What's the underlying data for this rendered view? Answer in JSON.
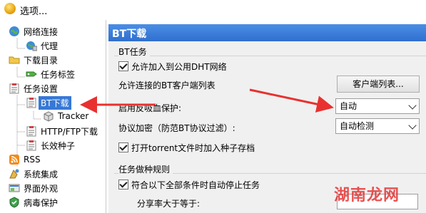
{
  "window": {
    "title": "选项..."
  },
  "tree": {
    "items": [
      {
        "label": "网络连接",
        "icon": "network-globe-icon"
      },
      {
        "label": "代理",
        "icon": "proxy-globe-icon"
      },
      {
        "label": "下载目录",
        "icon": "folder-icon"
      },
      {
        "label": "任务标签",
        "icon": "tag-icon"
      },
      {
        "label": "任务设置",
        "icon": "task-settings-icon"
      },
      {
        "label": "BT下载",
        "icon": "bt-task-icon"
      },
      {
        "label": "Tracker",
        "icon": "tracker-box-icon"
      },
      {
        "label": "HTTP/FTP下载",
        "icon": "http-ftp-icon"
      },
      {
        "label": "长效种子",
        "icon": "long-seed-icon"
      },
      {
        "label": "RSS",
        "icon": "rss-icon"
      },
      {
        "label": "系统集成",
        "icon": "system-integration-icon"
      },
      {
        "label": "界面外观",
        "icon": "appearance-icon"
      },
      {
        "label": "病毒保护",
        "icon": "virus-protection-icon"
      }
    ],
    "selected": "BT下载"
  },
  "panel": {
    "header": "BT下载",
    "bt_group": {
      "title": "BT任务",
      "allow_dht_label": "允许加入到公用DHT网络",
      "allow_dht_checked": true,
      "allowed_clients_label": "允许连接的BT客户端列表",
      "client_list_button": "客户端列表...",
      "anti_leech_label": "启用反吸血保护:",
      "anti_leech_value": "自动",
      "encryption_label": "协议加密（防范BT协议过滤）:",
      "encryption_value": "自动检测",
      "torrent_seed_label": "打开torrent文件时加入种子存档",
      "torrent_seed_checked": true
    },
    "seed_rules_group": {
      "title": "任务做种规则",
      "stop_all_label": "符合以下全部条件时自动停止任务",
      "stop_all_checked": true,
      "share_ratio_label": "分享率大于等于:"
    }
  },
  "watermark": "湖南龙网",
  "colors": {
    "header": "#3778d6",
    "selection": "#3778d6",
    "annotation_arrow": "#e8312f"
  }
}
